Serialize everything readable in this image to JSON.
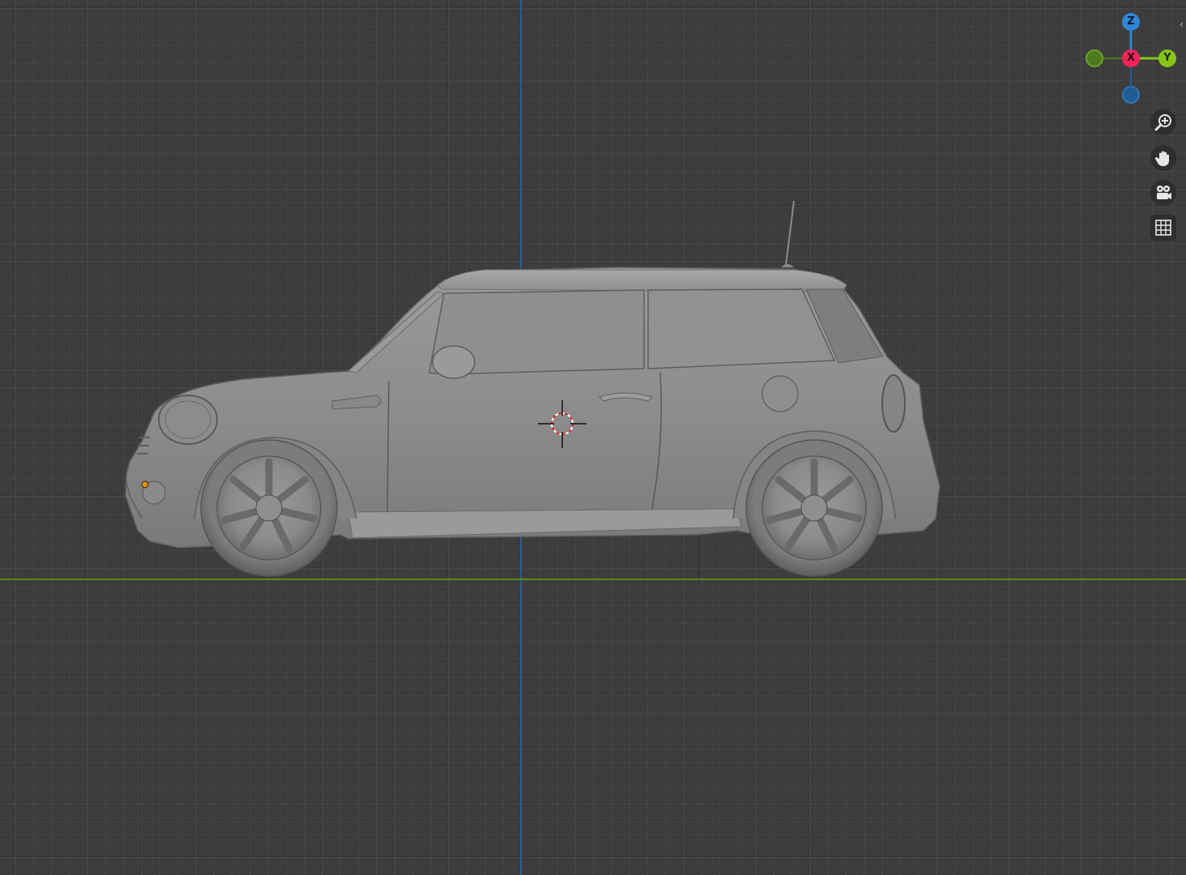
{
  "viewport": {
    "background_color": "#3d3d3d",
    "grid_color": "#4a4a4a",
    "axis_colors": {
      "z": "#2b5f8f",
      "y": "#5a8a1c"
    }
  },
  "gizmo": {
    "z_label": "Z",
    "x_label": "X",
    "y_label": "Y",
    "colors": {
      "x": "#f0245a",
      "y": "#86c41a",
      "z": "#2f86d8"
    }
  },
  "nav_buttons": [
    {
      "name": "zoom",
      "icon": "magnifier-plus-icon"
    },
    {
      "name": "pan",
      "icon": "hand-icon"
    },
    {
      "name": "camera",
      "icon": "camera-icon"
    },
    {
      "name": "orthographic",
      "icon": "grid-icon"
    }
  ],
  "scene": {
    "object": "car-model",
    "body_color": "#8a8a8a",
    "origin_point_color": "#e8900f"
  }
}
